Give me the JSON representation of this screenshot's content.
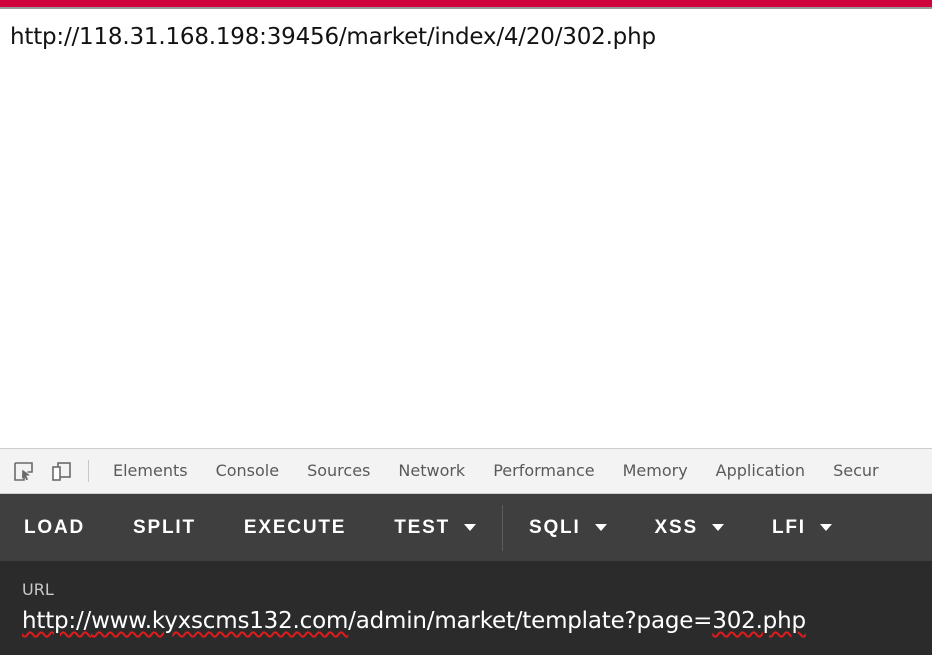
{
  "browser": {
    "accent_color": "#d0043c",
    "page_url_text": "http://118.31.168.198:39456/market/index/4/20/302.php"
  },
  "devtools": {
    "inspect_icon": "inspect-element-icon",
    "device_icon": "device-toolbar-icon",
    "tabs": [
      {
        "label": "Elements"
      },
      {
        "label": "Console"
      },
      {
        "label": "Sources"
      },
      {
        "label": "Network"
      },
      {
        "label": "Performance"
      },
      {
        "label": "Memory"
      },
      {
        "label": "Application"
      },
      {
        "label": "Secur"
      }
    ]
  },
  "action_toolbar": {
    "background_color": "#3f3f3f",
    "buttons": [
      {
        "label": "LOAD",
        "has_caret": false
      },
      {
        "label": "SPLIT",
        "has_caret": false
      },
      {
        "label": "EXECUTE",
        "has_caret": false
      },
      {
        "label": "TEST",
        "has_caret": true
      },
      {
        "label": "SQLI",
        "has_caret": true
      },
      {
        "label": "XSS",
        "has_caret": true
      },
      {
        "label": "LFI",
        "has_caret": true
      }
    ]
  },
  "url_panel": {
    "background_color": "#2b2b2b",
    "label": "URL",
    "value_parts": [
      {
        "text": "http://",
        "spellerror": true
      },
      {
        "text": "www.kyxscms132.com",
        "spellerror": true
      },
      {
        "text": "/admin/market/template?page=",
        "spellerror": false
      },
      {
        "text": "302.php",
        "spellerror": true
      }
    ],
    "value": "http://www.kyxscms132.com/admin/market/template?page=302.php"
  }
}
